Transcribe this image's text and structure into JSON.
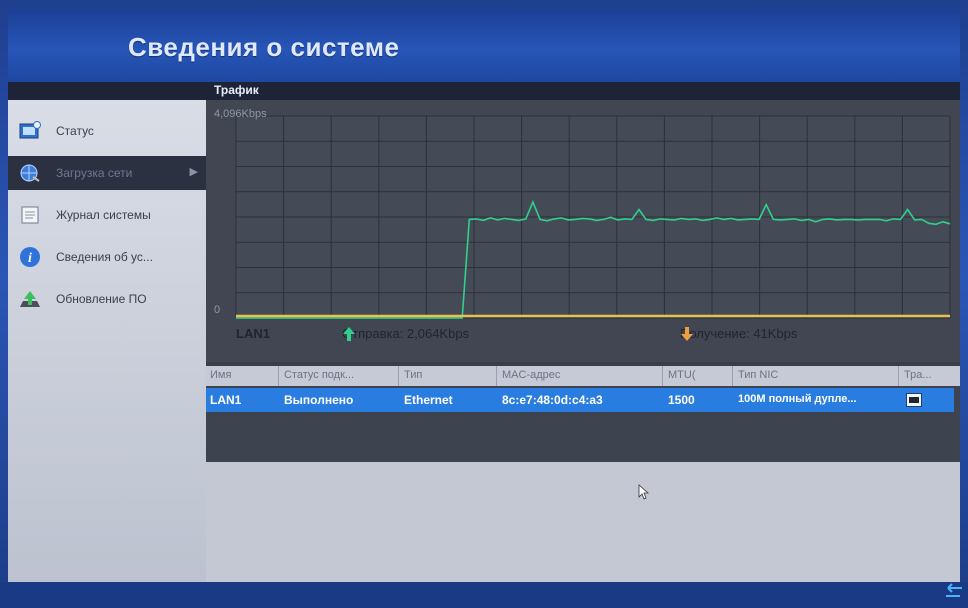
{
  "header": {
    "title": "Сведения о системе"
  },
  "section": {
    "label": "Трафик"
  },
  "sidebar": {
    "items": [
      {
        "label": "Статус",
        "icon": "status-icon"
      },
      {
        "label": "Загрузка сети",
        "icon": "network-icon"
      },
      {
        "label": "Журнал системы",
        "icon": "log-icon"
      },
      {
        "label": "Сведения об ус...",
        "icon": "info-icon"
      },
      {
        "label": "Обновление ПО",
        "icon": "upgrade-icon"
      }
    ]
  },
  "chart_data": {
    "type": "line",
    "ymax_label": "4,096Kbps",
    "ymin_label": "0",
    "ylim": [
      0,
      4096
    ],
    "grid": true,
    "series": [
      {
        "name": "Отправка",
        "color": "#2fd08a",
        "values": [
          0,
          0,
          0,
          0,
          0,
          0,
          0,
          0,
          0,
          0,
          0,
          0,
          0,
          0,
          0,
          0,
          0,
          0,
          0,
          0,
          0,
          0,
          0,
          0,
          0,
          0,
          0,
          0,
          0,
          0,
          0,
          0,
          0,
          2000,
          2010,
          1980,
          2030,
          1990,
          2020,
          2000,
          1980,
          2010,
          2350,
          2000,
          1970,
          2010,
          2030,
          1990,
          2000,
          2020,
          2010,
          1980,
          2000,
          2040,
          1990,
          2010,
          2000,
          2200,
          2000,
          1980,
          2010,
          2000,
          1990,
          2020,
          2000,
          2010,
          1980,
          2000,
          2030,
          2000,
          2020,
          1990,
          2000,
          2010,
          2000,
          2300,
          2000,
          1990,
          2000,
          2010,
          1980,
          2000,
          1950,
          2000,
          2010,
          1990,
          2000,
          2000,
          1990,
          2000,
          2000,
          2000,
          1970,
          2010,
          2000,
          2200,
          1990,
          2000,
          1920,
          1900,
          1950,
          1910
        ]
      },
      {
        "name": "Получение",
        "color": "#e8c24a",
        "values": [
          41,
          41,
          41,
          41,
          41,
          41,
          41,
          41,
          41,
          41,
          41,
          41,
          41,
          41,
          41,
          41,
          41,
          41,
          41,
          41,
          41,
          41,
          41,
          41,
          41,
          41,
          41,
          41,
          41,
          41,
          41,
          41,
          41,
          41,
          41,
          41,
          41,
          41,
          41,
          41,
          41,
          41,
          41,
          41,
          41,
          41,
          41,
          41,
          41,
          41,
          41,
          41,
          41,
          41,
          41,
          41,
          41,
          41,
          41,
          41,
          41,
          41,
          41,
          41,
          41,
          41,
          41,
          41,
          41,
          41,
          41,
          41,
          41,
          41,
          41,
          41,
          41,
          41,
          41,
          41,
          41,
          41,
          41,
          41,
          41,
          41,
          41,
          41,
          41,
          41,
          41,
          41,
          41,
          41,
          41,
          41,
          41,
          41,
          41,
          41,
          41
        ]
      }
    ]
  },
  "legend": {
    "lan": "LAN1",
    "send_label": "Отправка: 2,064Kbps",
    "recv_label": "Получение: 41Kbps",
    "send_color": "#2fd08a",
    "recv_color": "#e8a040"
  },
  "table": {
    "headers": [
      "Имя",
      "Статус подк...",
      "Тип",
      "MAC-адрес",
      "MTU(",
      "Тип NIC",
      "Тра..."
    ],
    "rows": [
      [
        "LAN1",
        "Выполнено",
        "Ethernet",
        "8c:e7:48:0d:c4:a3",
        "1500",
        "100M полный дупле..."
      ]
    ]
  }
}
